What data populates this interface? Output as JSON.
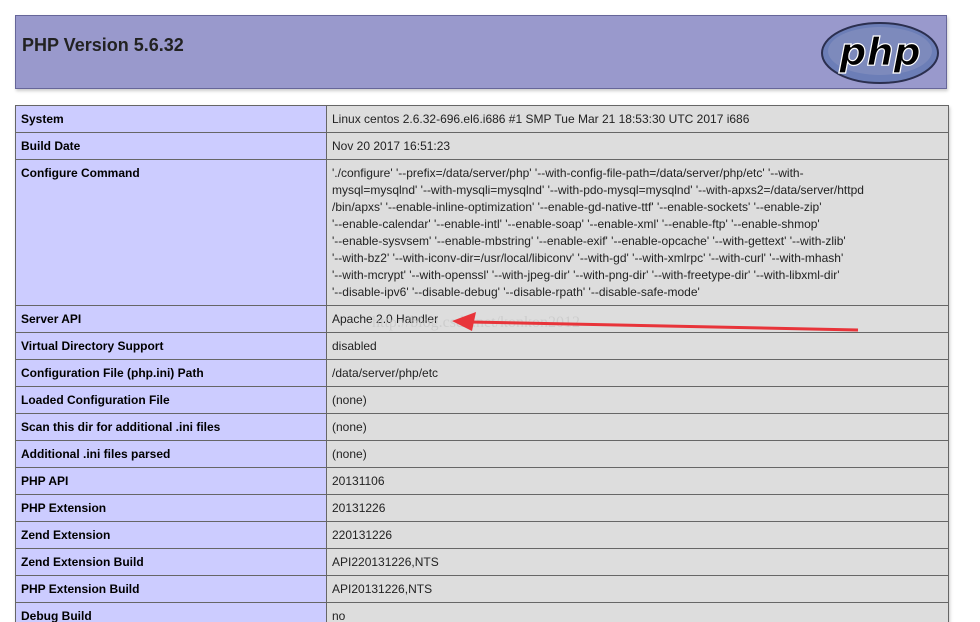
{
  "header": {
    "title": "PHP Version 5.6.32",
    "logo_text": "php"
  },
  "rows": [
    {
      "label": "System",
      "value": "Linux centos 2.6.32-696.el6.i686 #1 SMP Tue Mar 21 18:53:30 UTC 2017 i686"
    },
    {
      "label": "Build Date",
      "value": "Nov 20 2017 16:51:23"
    },
    {
      "label": "Configure Command",
      "value_lines": [
        "'./configure' '--prefix=/data/server/php' '--with-config-file-path=/data/server/php/etc' '--with-",
        "mysql=mysqlnd' '--with-mysqli=mysqlnd' '--with-pdo-mysql=mysqlnd' '--with-apxs2=/data/server/httpd",
        "/bin/apxs' '--enable-inline-optimization' '--enable-gd-native-ttf' '--enable-sockets' '--enable-zip'",
        "'--enable-calendar' '--enable-intl' '--enable-soap' '--enable-xml' '--enable-ftp' '--enable-shmop'",
        "'--enable-sysvsem' '--enable-mbstring' '--enable-exif' '--enable-opcache' '--with-gettext' '--with-zlib'",
        "'--with-bz2' '--with-iconv-dir=/usr/local/libiconv' '--with-gd' '--with-xmlrpc' '--with-curl' '--with-mhash'",
        "'--with-mcrypt' '--with-openssl' '--with-jpeg-dir' '--with-png-dir' '--with-freetype-dir' '--with-libxml-dir'",
        "'--disable-ipv6' '--disable-debug' '--disable-rpath' '--disable-safe-mode'"
      ]
    },
    {
      "label": "Server API",
      "value": "Apache 2.0 Handler"
    },
    {
      "label": "Virtual Directory Support",
      "value": "disabled"
    },
    {
      "label": "Configuration File (php.ini) Path",
      "value": "/data/server/php/etc"
    },
    {
      "label": "Loaded Configuration File",
      "value": "(none)"
    },
    {
      "label": "Scan this dir for additional .ini files",
      "value": "(none)"
    },
    {
      "label": "Additional .ini files parsed",
      "value": "(none)"
    },
    {
      "label": "PHP API",
      "value": "20131106"
    },
    {
      "label": "PHP Extension",
      "value": "20131226"
    },
    {
      "label": "Zend Extension",
      "value": "220131226"
    },
    {
      "label": "Zend Extension Build",
      "value": "API220131226,NTS"
    },
    {
      "label": "PHP Extension Build",
      "value": "API20131226,NTS"
    },
    {
      "label": "Debug Build",
      "value": "no"
    }
  ],
  "annotation": {
    "watermark": "http://blog.csdn.net/konkon2012",
    "arrow_color": "#e8343a"
  },
  "colors": {
    "header_bg": "#9999cc",
    "label_bg": "#ccccff",
    "value_bg": "#dddddd"
  }
}
